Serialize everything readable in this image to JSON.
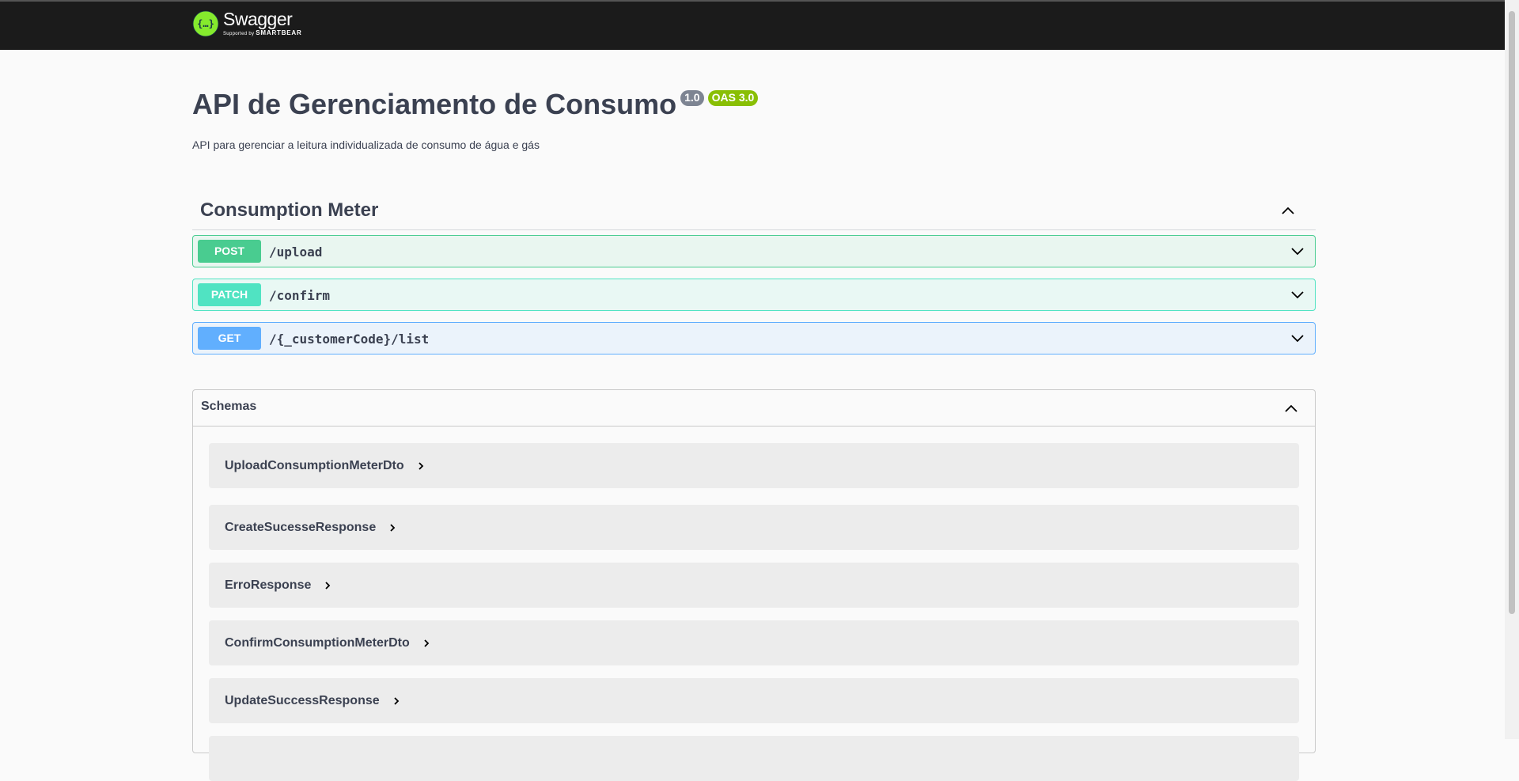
{
  "topbar": {
    "brand_name": "Swagger",
    "tagline_prefix": "Supported by",
    "tagline_brand": "SMARTBEAR",
    "logo_icon": "swagger-logo-icon"
  },
  "info": {
    "title": "API de Gerenciamento de Consumo",
    "version": "1.0",
    "oas": "OAS 3.0",
    "description": "API para gerenciar a leitura individualizada de consumo de água e gás"
  },
  "tag": {
    "title": "Consumption Meter",
    "toggle_icon": "chevron-up-icon",
    "operations": [
      {
        "method": "POST",
        "path": "/upload"
      },
      {
        "method": "PATCH",
        "path": "/confirm"
      },
      {
        "method": "GET",
        "path": "/{_customerCode}/list"
      }
    ]
  },
  "schemas": {
    "title": "Schemas",
    "items": [
      "UploadConsumptionMeterDto",
      "CreateSucesseResponse",
      "ErroResponse",
      "ConfirmConsumptionMeterDto",
      "UpdateSuccessResponse"
    ]
  },
  "colors": {
    "post": "#49cc90",
    "patch": "#50e3c2",
    "get": "#61affe",
    "topbar": "#1b1b1b",
    "oas_badge": "#89bf04",
    "version_badge": "#7d8492"
  }
}
